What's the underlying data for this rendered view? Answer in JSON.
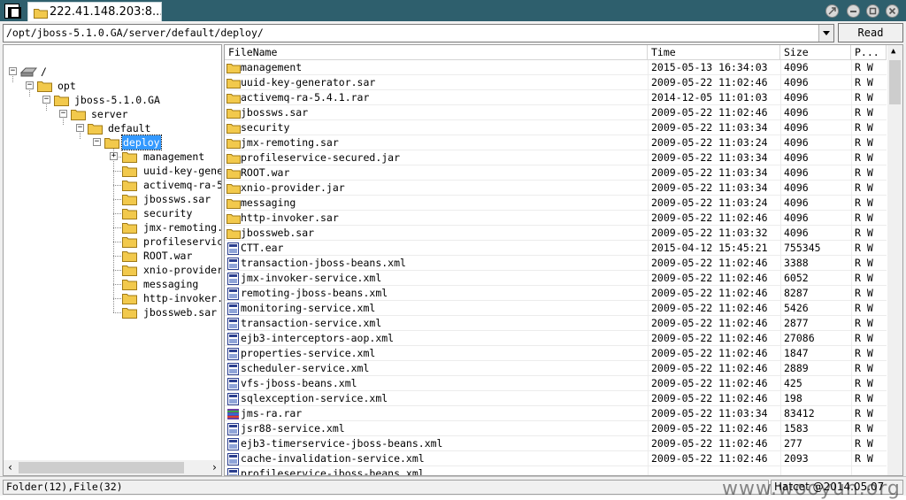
{
  "window": {
    "tab_title": "222.41.148.203:8..."
  },
  "toolbar": {
    "path": "/opt/jboss-5.1.0.GA/server/default/deploy/",
    "read_label": "Read"
  },
  "tree": {
    "root": "/",
    "nodes": [
      "opt",
      "jboss-5.1.0.GA",
      "server",
      "default",
      "deploy"
    ],
    "children": [
      "management",
      "uuid-key-gene",
      "activemq-ra-5",
      "jbossws.sar",
      "security",
      "jmx-remoting.",
      "profileservic",
      "ROOT.war",
      "xnio-provider",
      "messaging",
      "http-invoker.",
      "jbossweb.sar"
    ]
  },
  "columns": {
    "name": "FileName",
    "time": "Time",
    "size": "Size",
    "perm": "P..."
  },
  "files": [
    {
      "name": "management",
      "time": "2015-05-13 16:34:03",
      "size": "4096",
      "perm": "R W",
      "type": "folder"
    },
    {
      "name": "uuid-key-generator.sar",
      "time": "2009-05-22 11:02:46",
      "size": "4096",
      "perm": "R W",
      "type": "folder"
    },
    {
      "name": "activemq-ra-5.4.1.rar",
      "time": "2014-12-05 11:01:03",
      "size": "4096",
      "perm": "R W",
      "type": "folder"
    },
    {
      "name": "jbossws.sar",
      "time": "2009-05-22 11:02:46",
      "size": "4096",
      "perm": "R W",
      "type": "folder"
    },
    {
      "name": "security",
      "time": "2009-05-22 11:03:34",
      "size": "4096",
      "perm": "R W",
      "type": "folder"
    },
    {
      "name": "jmx-remoting.sar",
      "time": "2009-05-22 11:03:24",
      "size": "4096",
      "perm": "R W",
      "type": "folder"
    },
    {
      "name": "profileservice-secured.jar",
      "time": "2009-05-22 11:03:34",
      "size": "4096",
      "perm": "R W",
      "type": "folder"
    },
    {
      "name": "ROOT.war",
      "time": "2009-05-22 11:03:34",
      "size": "4096",
      "perm": "R W",
      "type": "folder"
    },
    {
      "name": "xnio-provider.jar",
      "time": "2009-05-22 11:03:34",
      "size": "4096",
      "perm": "R W",
      "type": "folder"
    },
    {
      "name": "messaging",
      "time": "2009-05-22 11:03:24",
      "size": "4096",
      "perm": "R W",
      "type": "folder"
    },
    {
      "name": "http-invoker.sar",
      "time": "2009-05-22 11:02:46",
      "size": "4096",
      "perm": "R W",
      "type": "folder"
    },
    {
      "name": "jbossweb.sar",
      "time": "2009-05-22 11:03:32",
      "size": "4096",
      "perm": "R W",
      "type": "folder"
    },
    {
      "name": "CTT.ear",
      "time": "2015-04-12 15:45:21",
      "size": "755345",
      "perm": "R W",
      "type": "file"
    },
    {
      "name": "transaction-jboss-beans.xml",
      "time": "2009-05-22 11:02:46",
      "size": "3388",
      "perm": "R W",
      "type": "file"
    },
    {
      "name": "jmx-invoker-service.xml",
      "time": "2009-05-22 11:02:46",
      "size": "6052",
      "perm": "R W",
      "type": "file"
    },
    {
      "name": "remoting-jboss-beans.xml",
      "time": "2009-05-22 11:02:46",
      "size": "8287",
      "perm": "R W",
      "type": "file"
    },
    {
      "name": "monitoring-service.xml",
      "time": "2009-05-22 11:02:46",
      "size": "5426",
      "perm": "R W",
      "type": "file"
    },
    {
      "name": "transaction-service.xml",
      "time": "2009-05-22 11:02:46",
      "size": "2877",
      "perm": "R W",
      "type": "file"
    },
    {
      "name": "ejb3-interceptors-aop.xml",
      "time": "2009-05-22 11:02:46",
      "size": "27086",
      "perm": "R W",
      "type": "file"
    },
    {
      "name": "properties-service.xml",
      "time": "2009-05-22 11:02:46",
      "size": "1847",
      "perm": "R W",
      "type": "file"
    },
    {
      "name": "scheduler-service.xml",
      "time": "2009-05-22 11:02:46",
      "size": "2889",
      "perm": "R W",
      "type": "file"
    },
    {
      "name": "vfs-jboss-beans.xml",
      "time": "2009-05-22 11:02:46",
      "size": "425",
      "perm": "R W",
      "type": "file"
    },
    {
      "name": "sqlexception-service.xml",
      "time": "2009-05-22 11:02:46",
      "size": "198",
      "perm": "R W",
      "type": "file"
    },
    {
      "name": "jms-ra.rar",
      "time": "2009-05-22 11:03:34",
      "size": "83412",
      "perm": "R W",
      "type": "archive"
    },
    {
      "name": "jsr88-service.xml",
      "time": "2009-05-22 11:02:46",
      "size": "1583",
      "perm": "R W",
      "type": "file"
    },
    {
      "name": "ejb3-timerservice-jboss-beans.xml",
      "time": "2009-05-22 11:02:46",
      "size": "277",
      "perm": "R W",
      "type": "file"
    },
    {
      "name": "cache-invalidation-service.xml",
      "time": "2009-05-22 11:02:46",
      "size": "2093",
      "perm": "R W",
      "type": "file"
    },
    {
      "name": "profileservice-jboss-beans.xml",
      "time": "",
      "size": "",
      "perm": "",
      "type": "file"
    }
  ],
  "status": {
    "left": "Folder(12),File(32)",
    "right": "Hatcet @2014.05.07"
  },
  "watermark": "www.wooyun.org",
  "colors": {
    "title_bg": "#2e5f6d",
    "selection": "#3399ff",
    "folder": "#f2c94c"
  }
}
